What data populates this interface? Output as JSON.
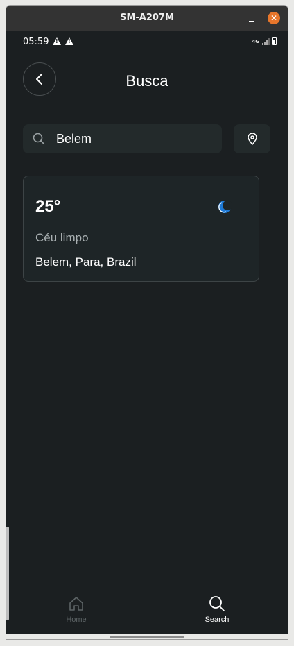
{
  "window": {
    "title": "SM-A207M",
    "close_glyph": "✕"
  },
  "statusbar": {
    "time": "05:59",
    "network": "4G"
  },
  "header": {
    "title": "Busca",
    "back_icon": "chevron-left-icon"
  },
  "search": {
    "value": "Belem",
    "placeholder": ""
  },
  "result": {
    "temperature": "25°",
    "condition": "Céu limpo",
    "location": "Belem, Para, Brazil",
    "icon": "moon-icon"
  },
  "nav": {
    "items": [
      {
        "label": "Home",
        "icon": "home-icon",
        "active": false
      },
      {
        "label": "Search",
        "icon": "search-icon",
        "active": true
      }
    ]
  },
  "colors": {
    "background": "#1b1f21",
    "field": "#232a2b",
    "accent_moon": "#1e7ad6",
    "close": "#e8762b"
  }
}
